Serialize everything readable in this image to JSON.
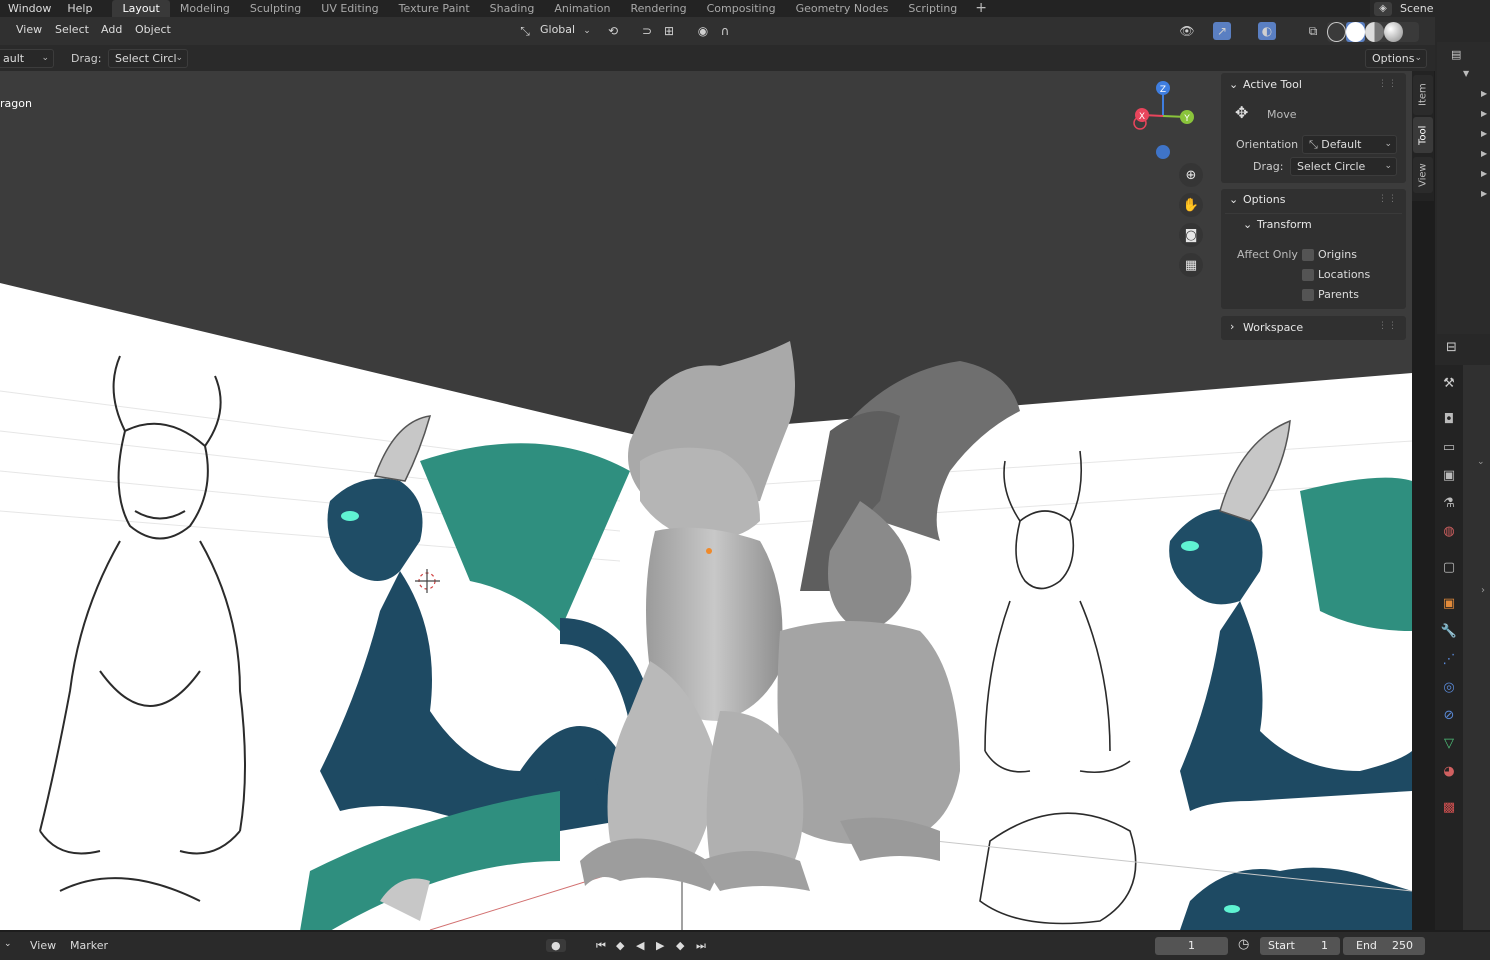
{
  "menubar": {
    "menus": [
      "Window",
      "Help"
    ],
    "workspaces": [
      "Layout",
      "Modeling",
      "Sculpting",
      "UV Editing",
      "Texture Paint",
      "Shading",
      "Animation",
      "Rendering",
      "Compositing",
      "Geometry Nodes",
      "Scripting"
    ],
    "active_workspace": "Layout",
    "add_tab": "+",
    "scene": "Scene"
  },
  "viewport_header": {
    "menus": [
      "View",
      "Select",
      "Add",
      "Object"
    ],
    "orientation": "Global"
  },
  "tool_header": {
    "mode_partial": "ault",
    "drag_label": "Drag:",
    "drag_value": "Select Circl",
    "options_label": "Options"
  },
  "viewport": {
    "object_name_partial": "ragon"
  },
  "gizmo": {
    "x_label": "X",
    "y_label": "Y",
    "z_label": "Z"
  },
  "npanel": {
    "tabs": [
      "Item",
      "Tool",
      "View"
    ],
    "active_tab": "Tool",
    "active_tool": {
      "header": "Active Tool",
      "tool_name": "Move",
      "orientation_label": "Orientation",
      "orientation_value": "Default",
      "drag_label": "Drag:",
      "drag_value": "Select Circle"
    },
    "options": {
      "header": "Options",
      "transform_header": "Transform",
      "affect_only_label": "Affect Only",
      "checkboxes": [
        "Origins",
        "Locations",
        "Parents"
      ]
    },
    "workspace": {
      "header": "Workspace"
    }
  },
  "timeline": {
    "menus": [
      "View",
      "Marker"
    ],
    "current_frame": "1",
    "start_label": "Start",
    "start_value": "1",
    "end_label": "End",
    "end_value": "250"
  },
  "colors": {
    "accent_blue": "#5a7fc2",
    "axis_x": "#e8455c",
    "axis_y": "#8ac43b",
    "axis_z": "#3f7ee0"
  }
}
